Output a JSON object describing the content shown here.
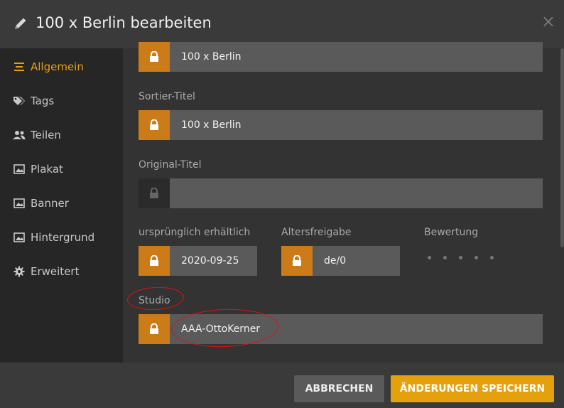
{
  "header": {
    "title": "100 x Berlin bearbeiten",
    "close_glyph": "×"
  },
  "sidebar": {
    "items": [
      {
        "label": "Allgemein",
        "icon": "list-icon",
        "active": true
      },
      {
        "label": "Tags",
        "icon": "tag-icon"
      },
      {
        "label": "Teilen",
        "icon": "users-icon"
      },
      {
        "label": "Plakat",
        "icon": "image-icon"
      },
      {
        "label": "Banner",
        "icon": "image-icon"
      },
      {
        "label": "Hintergrund",
        "icon": "image-icon"
      },
      {
        "label": "Erweitert",
        "icon": "gear-icon"
      }
    ]
  },
  "form": {
    "title": {
      "value": "100 x Berlin"
    },
    "sort_title": {
      "label": "Sortier-Titel",
      "value": "100 x Berlin"
    },
    "original_title": {
      "label": "Original-Titel",
      "value": ""
    },
    "release": {
      "label": "ursprünglich erhältlich",
      "value": "2020-09-25"
    },
    "age_rating": {
      "label": "Altersfreigabe",
      "value": "de/0"
    },
    "rating": {
      "label": "Bewertung",
      "stars": 0,
      "max": 5
    },
    "studio": {
      "label": "Studio",
      "value": "AAA-OttoKerner"
    }
  },
  "footer": {
    "cancel_label": "ABBRECHEN",
    "save_label": "ÄNDERUNGEN SPEICHERN"
  },
  "colors": {
    "accent": "#e5a00d",
    "lock": "#cc7b19",
    "annotation": "#e01010"
  }
}
